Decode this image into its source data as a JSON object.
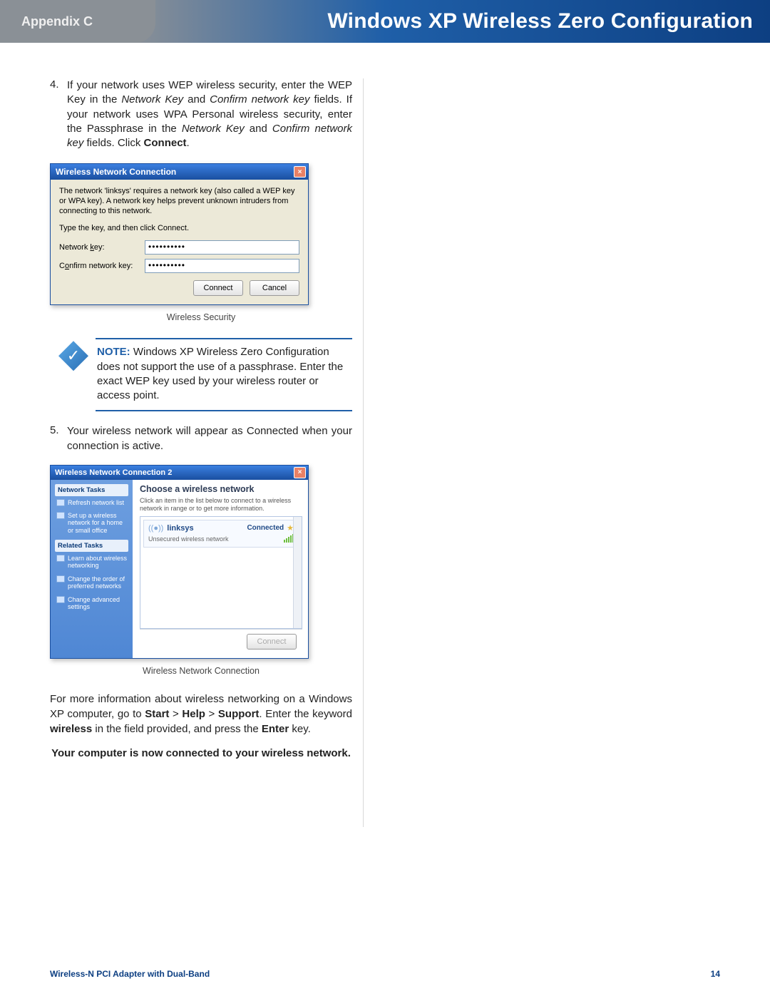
{
  "header": {
    "left": "Appendix C",
    "right": "Windows XP Wireless Zero Configuration"
  },
  "step4": {
    "num": "4.",
    "text_a": "If your network uses WEP wireless security, enter the WEP Key in the ",
    "em1": "Network Key",
    "text_b": " and ",
    "em2": "Confirm network key",
    "text_c": " fields. If your network uses WPA Personal wireless security, enter the Passphrase in the ",
    "em3": "Network Key",
    "text_d": " and ",
    "em4": "Confirm network key",
    "text_e": " fields. Click ",
    "bold": "Connect",
    "text_f": "."
  },
  "dlg1": {
    "title": "Wireless Network Connection",
    "desc": "The network 'linksys' requires a network key (also called a WEP key or WPA key). A network key helps prevent unknown intruders from connecting to this network.",
    "instr": "Type the key, and then click Connect.",
    "label_key_pre": "Network ",
    "label_key_u": "k",
    "label_key_post": "ey:",
    "label_conf_pre": "C",
    "label_conf_u": "o",
    "label_conf_post": "nfirm network key:",
    "field_value": "••••••••••",
    "btn_connect": "Connect",
    "btn_cancel": "Cancel"
  },
  "caption1": "Wireless Security",
  "note": {
    "label": "NOTE:",
    "text": " Windows XP Wireless Zero Configuration does not support the use of a passphrase. Enter the exact WEP key used by your wireless router or access point."
  },
  "step5": {
    "num": "5.",
    "text": "Your wireless network will appear as Connected when your connection is active."
  },
  "dlg2": {
    "title": "Wireless Network Connection 2",
    "side_head1": "Network Tasks",
    "side_item1": "Refresh network list",
    "side_item2": "Set up a wireless network for a home or small office",
    "side_head2": "Related Tasks",
    "side_item3": "Learn about wireless networking",
    "side_item4": "Change the order of preferred networks",
    "side_item5": "Change advanced settings",
    "main_head": "Choose a wireless network",
    "main_sub": "Click an item in the list below to connect to a wireless network in range or to get more information.",
    "net_name": "linksys",
    "net_status": "Connected",
    "net_sec": "Unsecured wireless network",
    "btn": "Connect"
  },
  "caption2": "Wireless Network Connection",
  "para": {
    "a": "For more information about wireless networking on a Windows XP computer, go to ",
    "b1": "Start",
    "gt1": " > ",
    "b2": "Help",
    "gt2": " > ",
    "b3": "Support",
    "c": ". Enter the keyword ",
    "b4": "wireless",
    "d": " in the field provided, and press the ",
    "b5": "Enter",
    "e": " key."
  },
  "conclusion": "Your computer is now connected to your wireless network.",
  "footer": {
    "product": "Wireless-N PCI Adapter with Dual-Band",
    "page": "14"
  }
}
